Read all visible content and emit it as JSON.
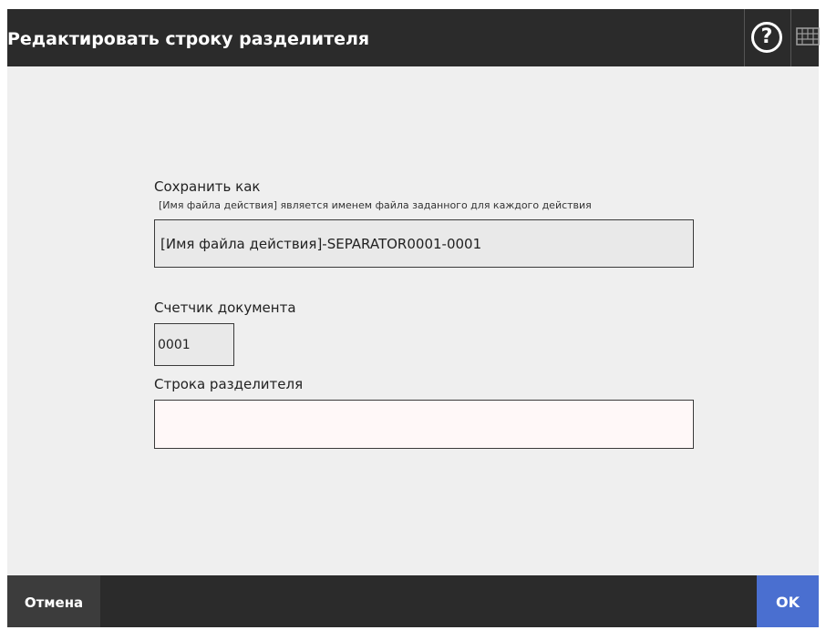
{
  "header": {
    "title": "Редактировать строку разделителя",
    "help_symbol": "?",
    "help_icon": "help-circle-icon",
    "keyboard_icon": "keyboard-icon"
  },
  "form": {
    "save_as": {
      "label": "Сохранить как",
      "note": "[Имя файла действия] является именем файла заданного для каждого действия",
      "value": "[Имя файла действия]-SEPARATOR0001-0001"
    },
    "doc_counter": {
      "label": "Счетчик документа",
      "value": "0001"
    },
    "separator_string": {
      "label": "Строка разделителя",
      "value": ""
    }
  },
  "footer": {
    "cancel_label": "Отмена",
    "ok_label": "OK"
  },
  "colors": {
    "header_bg": "#2b2b2b",
    "body_bg": "#efefef",
    "ok_button": "#4a6fd0",
    "cancel_button": "#3c3c3c"
  }
}
